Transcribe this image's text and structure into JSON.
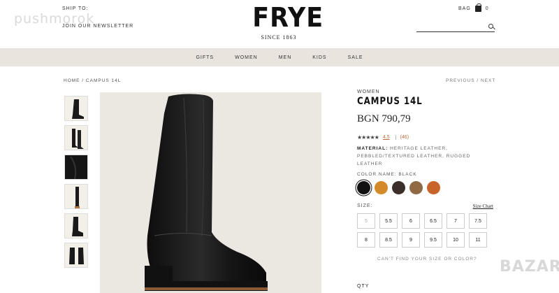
{
  "header": {
    "ship_to": "SHIP TO:",
    "newsletter": "JOIN OUR NEWSLETTER",
    "logo": "FRYE",
    "since": "SINCE 1863",
    "bag_label": "BAG",
    "bag_count": "0",
    "search_placeholder": ""
  },
  "watermarks": {
    "left": "pushmorok",
    "right": "BAZAR"
  },
  "nav": {
    "items": [
      {
        "label": "GIFTS"
      },
      {
        "label": "WOMEN"
      },
      {
        "label": "MEN"
      },
      {
        "label": "KIDS"
      },
      {
        "label": "SALE"
      }
    ]
  },
  "breadcrumb": "HOME / CAMPUS 14L",
  "pager": "PREVIOUS / NEXT",
  "product": {
    "category": "WOMEN",
    "name": "CAMPUS 14L",
    "price": "BGN 790,79",
    "stars": "★★★★★",
    "rating": "4.5",
    "reviews": "(46)",
    "material_label": "MATERIAL:",
    "material_value": "HERITAGE LEATHER, PEBBLED/TEXTURED LEATHER, RUGGED LEATHER",
    "color_label": "COLOR NAME:",
    "color_value": "BLACK",
    "swatches": [
      {
        "name": "black",
        "color": "#111111"
      },
      {
        "name": "tan",
        "color": "#d58a2a"
      },
      {
        "name": "dark brown",
        "color": "#3b2f2a"
      },
      {
        "name": "walnut",
        "color": "#8f6a45"
      },
      {
        "name": "cognac",
        "color": "#c8642a"
      }
    ],
    "size_label": "SIZE:",
    "size_chart": "Size Chart",
    "sizes": [
      "5",
      "5.5",
      "6",
      "6.5",
      "7",
      "7.5",
      "8",
      "8.5",
      "9",
      "9.5",
      "10",
      "11"
    ],
    "cant_find": "CAN'T FIND YOUR SIZE OR COLOR?",
    "qty_label": "QTY"
  },
  "colors": {
    "nav_bg": "#e9e5de",
    "accent": "#c06b3c"
  }
}
